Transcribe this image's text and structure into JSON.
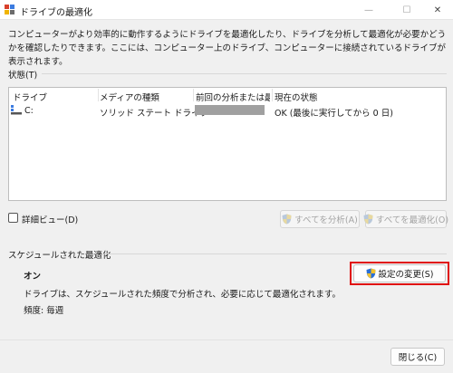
{
  "window": {
    "title": "ドライブの最適化",
    "controls": {
      "minimize": "—",
      "maximize": "☐",
      "close": "✕"
    }
  },
  "description": "コンピューターがより効率的に動作するようにドライブを最適化したり、ドライブを分析して最適化が必要かどうかを確認したりできます。ここには、コンピューター上のドライブ、コンピューターに接続されているドライブが表示されます。",
  "status_section": {
    "label": "状態(T)",
    "columns": [
      "ドライブ",
      "メディアの種類",
      "前回の分析または最...",
      "現在の状態"
    ],
    "rows": [
      {
        "drive": "C:",
        "media": "ソリッド ステート ドライブ",
        "status": "OK (最後に実行してから 0 日)"
      }
    ]
  },
  "advanced_view_label": "詳細ビュー(D)",
  "buttons": {
    "analyze_all": "すべてを分析(A)",
    "optimize_all": "すべてを最適化(O)",
    "change_settings": "設定の変更(S)",
    "close": "閉じる(C)"
  },
  "schedule_section": {
    "label": "スケジュールされた最適化",
    "state": "オン",
    "detail": "ドライブは、スケジュールされた頻度で分析され、必要に応じて最適化されます。",
    "frequency": "頻度: 毎週"
  },
  "colors": {
    "highlight": "#e01010",
    "shield_blue": "#2a6fd6",
    "shield_yellow": "#f2c230"
  }
}
